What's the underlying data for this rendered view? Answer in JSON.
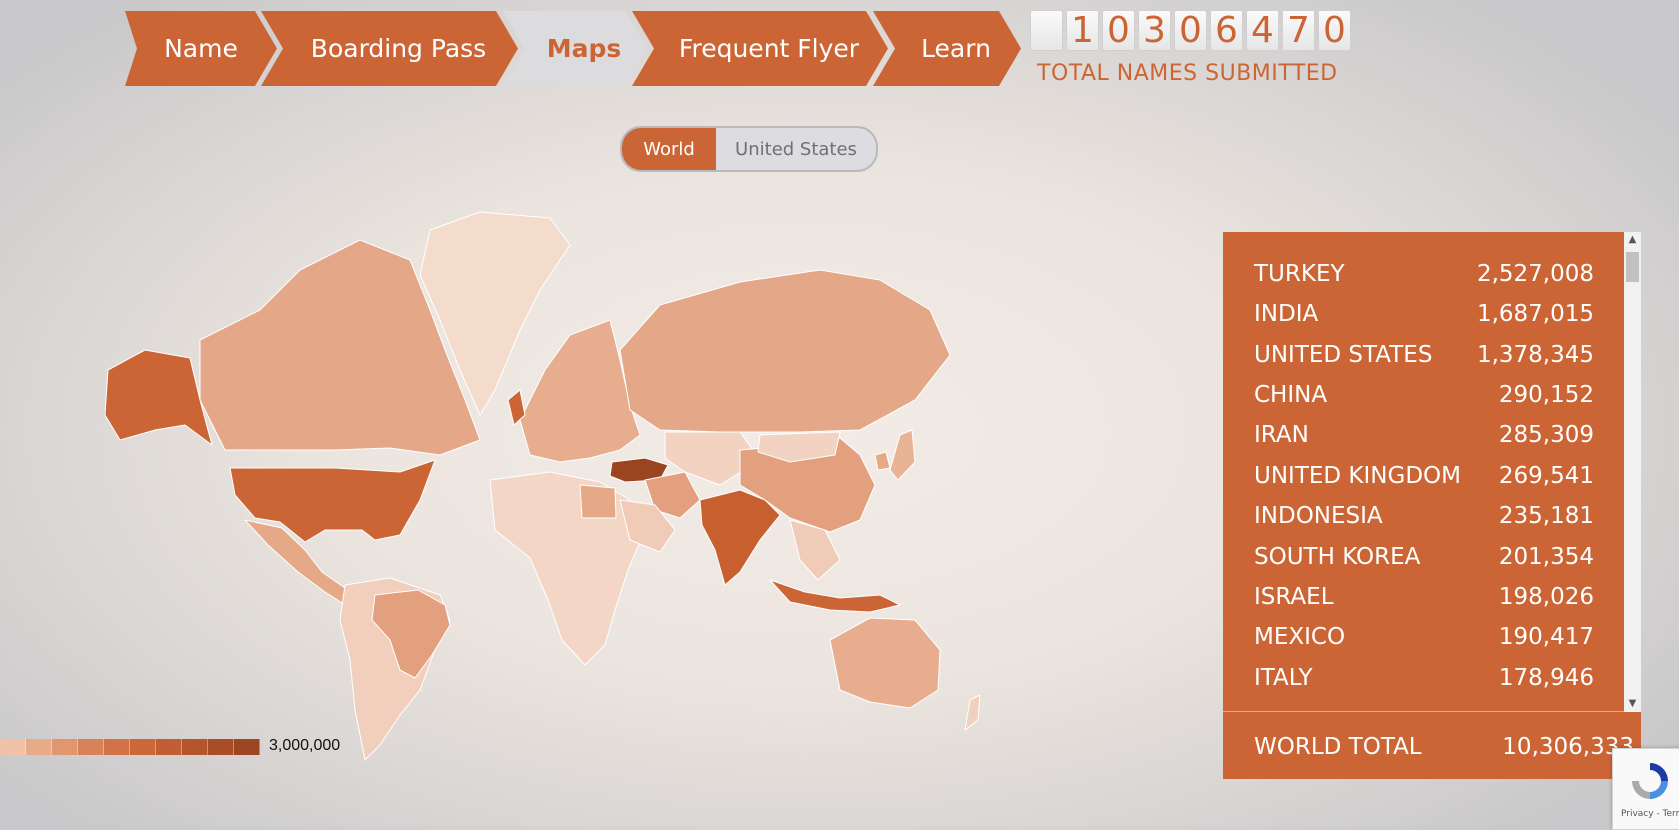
{
  "nav": {
    "items": [
      {
        "label": "Name"
      },
      {
        "label": "Boarding Pass"
      },
      {
        "label": "Maps",
        "active": true
      },
      {
        "label": "Frequent Flyer"
      },
      {
        "label": "Learn"
      }
    ]
  },
  "counter": {
    "digits": [
      "",
      "1",
      "0",
      "3",
      "0",
      "6",
      "4",
      "7",
      "0"
    ],
    "label": "TOTAL NAMES SUBMITTED"
  },
  "toggle": {
    "world": "World",
    "us": "United States",
    "selected": "World"
  },
  "legend": {
    "max_label": "3,000,000"
  },
  "leaderboard": {
    "rows": [
      {
        "country": "TURKEY",
        "count": "2,527,008"
      },
      {
        "country": "INDIA",
        "count": "1,687,015"
      },
      {
        "country": "UNITED STATES",
        "count": "1,378,345"
      },
      {
        "country": "CHINA",
        "count": "290,152"
      },
      {
        "country": "IRAN",
        "count": "285,309"
      },
      {
        "country": "UNITED KINGDOM",
        "count": "269,541"
      },
      {
        "country": "INDONESIA",
        "count": "235,181"
      },
      {
        "country": "SOUTH KOREA",
        "count": "201,354"
      },
      {
        "country": "ISRAEL",
        "count": "198,026"
      },
      {
        "country": "MEXICO",
        "count": "190,417"
      },
      {
        "country": "ITALY",
        "count": "178,946"
      }
    ],
    "total_label": "WORLD TOTAL",
    "total_value": "10,306,333"
  },
  "captcha": {
    "text": "Privacy - Terms"
  },
  "colors": {
    "accent": "#cc6535",
    "nav_active_bg": "#dcdcdf",
    "map_light": "#f4d9ca",
    "map_mid": "#e2a07f",
    "map_dark": "#cc6535",
    "map_darkest": "#a04a22"
  }
}
